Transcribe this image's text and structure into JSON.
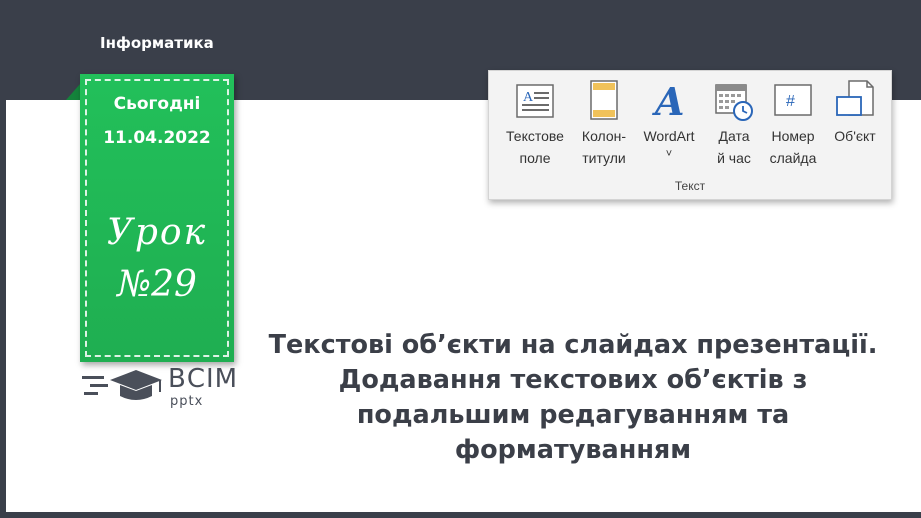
{
  "header": {
    "subject": "Інформатика"
  },
  "ribbon": {
    "date_label": "Сьогодні",
    "date_value": "11.04.2022",
    "lesson_word": "Урок",
    "lesson_number": "№29"
  },
  "logo": {
    "title": "ВСІМ",
    "subtitle": "pptx"
  },
  "toolbar": {
    "group_label": "Текст",
    "items": [
      {
        "line1": "Текстове",
        "line2": "поле",
        "icon": "text-box-icon"
      },
      {
        "line1": "Колон-",
        "line2": "титули",
        "icon": "header-footer-icon"
      },
      {
        "line1": "WordArt",
        "line2": "˅",
        "icon": "wordart-icon"
      },
      {
        "line1": "Дата",
        "line2": "й час",
        "icon": "date-time-icon"
      },
      {
        "line1": "Номер",
        "line2": "слайда",
        "icon": "slide-number-icon"
      },
      {
        "line1": "Об'єкт",
        "line2": "",
        "icon": "object-icon"
      }
    ]
  },
  "main": {
    "lines": [
      "Текстові об’єкти на слайдах презентації.",
      "Додавання текстових об’єктів з",
      "подальшим редагуванням та",
      "форматуванням"
    ]
  },
  "colors": {
    "accent_green": "#1fae51",
    "dark_bg": "#3a3f4a",
    "text_dark": "#3b3f48",
    "icon_blue": "#2a66b8"
  }
}
